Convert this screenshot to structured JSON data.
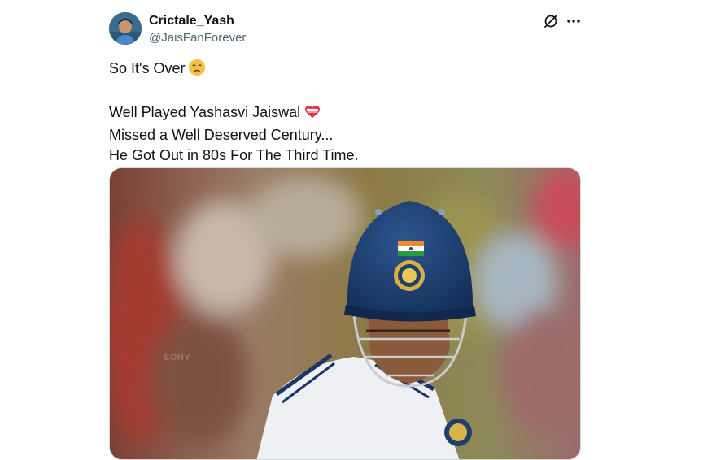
{
  "tweet": {
    "author": {
      "display_name": "Crictale_Yash",
      "handle": "@JaisFanForever"
    },
    "text_lines": [
      "So It's Over",
      "",
      "Well Played Yashasvi Jaiswal",
      "Missed a Well Deserved Century...",
      "He Got Out in 80s For The Third Time."
    ],
    "emojis": [
      "disappointed-face",
      "mending-heart"
    ],
    "media": {
      "watermark": "SONY",
      "description_icon": "batsman-photo"
    }
  },
  "icons": [
    "grok-icon",
    "more-options-icon"
  ],
  "colors": {
    "text_primary": "#0f1419",
    "text_secondary": "#536471",
    "helmet_blue": "#1f3f6e",
    "border": "#cfd9de"
  }
}
